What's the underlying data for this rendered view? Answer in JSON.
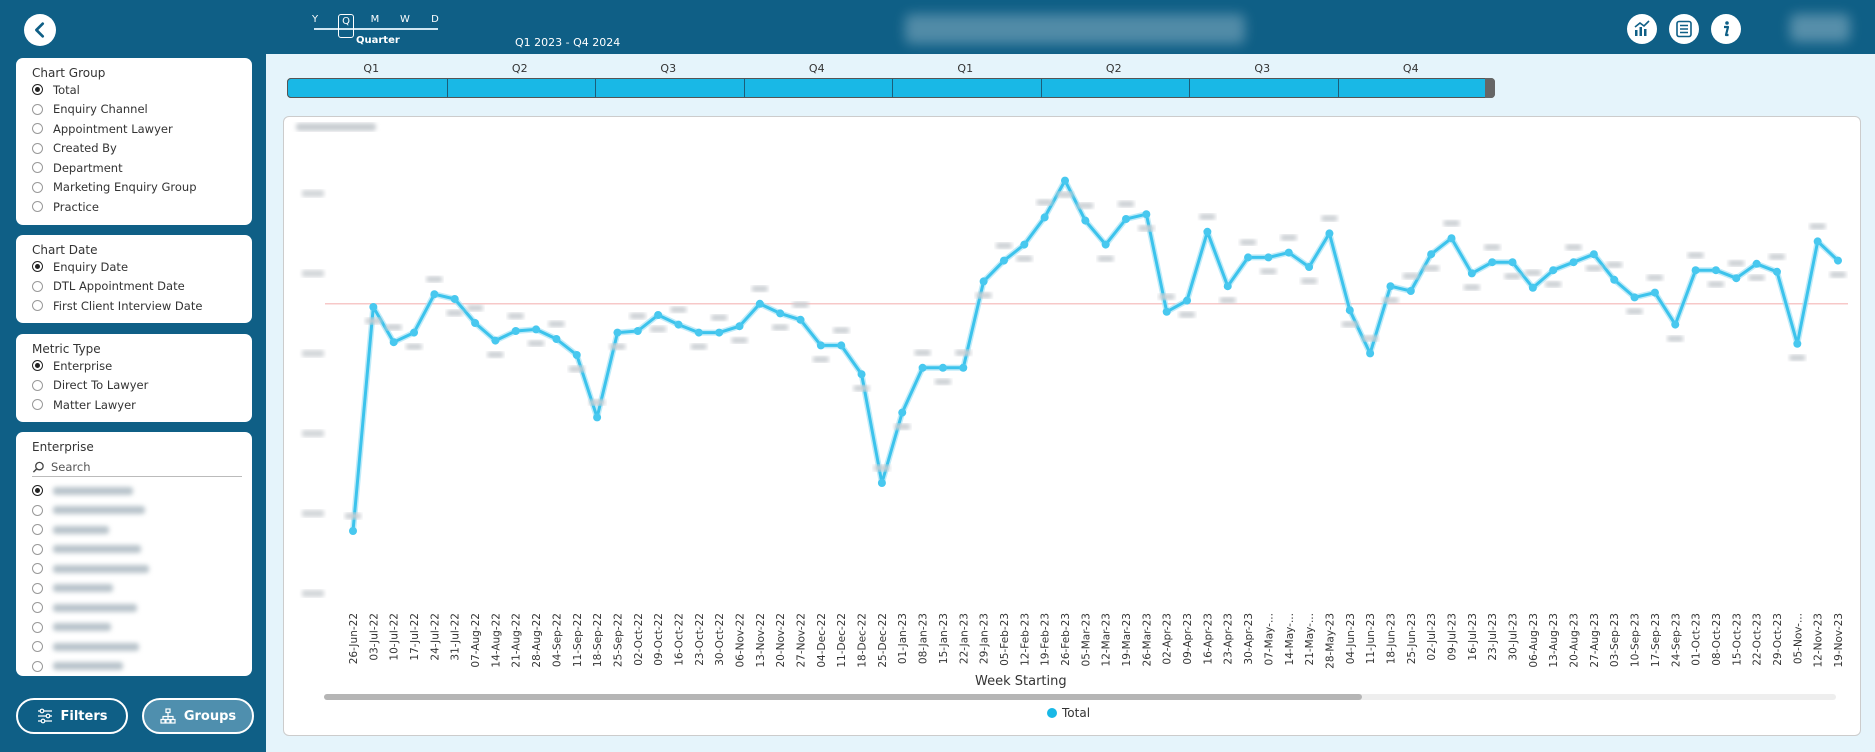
{
  "header": {
    "back_icon": "chevron-left-icon",
    "slicer": {
      "options": [
        "Y",
        "Q",
        "M",
        "W",
        "D"
      ],
      "selected": "Q",
      "selected_label": "Quarter"
    },
    "range_label": "Q1 2023 - Q4 2024",
    "icons": [
      "chart-analytics-icon",
      "list-report-icon",
      "info-icon"
    ]
  },
  "sidebar": {
    "chart_group": {
      "title": "Chart Group",
      "options": [
        "Total",
        "Enquiry Channel",
        "Appointment Lawyer",
        "Created By",
        "Department",
        "Marketing Enquiry Group",
        "Practice"
      ],
      "selected": "Total"
    },
    "chart_date": {
      "title": "Chart Date",
      "options": [
        "Enquiry Date",
        "DTL Appointment Date",
        "First Client Interview Date"
      ],
      "selected": "Enquiry Date"
    },
    "metric_type": {
      "title": "Metric Type",
      "options": [
        "Enterprise",
        "Direct To Lawyer",
        "Matter Lawyer"
      ],
      "selected": "Enterprise"
    },
    "enterprise": {
      "title": "Enterprise",
      "search_placeholder": "Search"
    },
    "filters_label": "Filters",
    "groups_label": "Groups"
  },
  "timeline": {
    "quarters": [
      "Q1",
      "Q2",
      "Q3",
      "Q4",
      "Q1",
      "Q2",
      "Q3",
      "Q4"
    ]
  },
  "chart_data": {
    "type": "line",
    "x": [
      "26-Jun-22",
      "03-Jul-22",
      "10-Jul-22",
      "17-Jul-22",
      "24-Jul-22",
      "31-Jul-22",
      "07-Aug-22",
      "14-Aug-22",
      "21-Aug-22",
      "28-Aug-22",
      "04-Sep-22",
      "11-Sep-22",
      "18-Sep-22",
      "25-Sep-22",
      "02-Oct-22",
      "09-Oct-22",
      "16-Oct-22",
      "23-Oct-22",
      "30-Oct-22",
      "06-Nov-22",
      "13-Nov-22",
      "20-Nov-22",
      "27-Nov-22",
      "04-Dec-22",
      "11-Dec-22",
      "18-Dec-22",
      "25-Dec-22",
      "01-Jan-23",
      "08-Jan-23",
      "15-Jan-23",
      "22-Jan-23",
      "29-Jan-23",
      "05-Feb-23",
      "12-Feb-23",
      "19-Feb-23",
      "26-Feb-23",
      "05-Mar-23",
      "12-Mar-23",
      "19-Mar-23",
      "26-Mar-23",
      "02-Apr-23",
      "09-Apr-23",
      "16-Apr-23",
      "23-Apr-23",
      "30-Apr-23",
      "07-May-...",
      "14-May-...",
      "21-May-...",
      "28-May-23",
      "04-Jun-23",
      "11-Jun-23",
      "18-Jun-23",
      "25-Jun-23",
      "02-Jul-23",
      "09-Jul-23",
      "16-Jul-23",
      "23-Jul-23",
      "30-Jul-23",
      "06-Aug-23",
      "13-Aug-23",
      "20-Aug-23",
      "27-Aug-23",
      "03-Sep-23",
      "10-Sep-23",
      "17-Sep-23",
      "24-Sep-23",
      "01-Oct-23",
      "08-Oct-23",
      "15-Oct-23",
      "22-Oct-23",
      "29-Oct-23",
      "05-Nov-...",
      "12-Nov-23",
      "19-Nov-23"
    ],
    "y": [
      40,
      180,
      158,
      164,
      188,
      185,
      170,
      159,
      165,
      166,
      160,
      150,
      111,
      164,
      165,
      175,
      169,
      164,
      164,
      168,
      182,
      176,
      172,
      156,
      156,
      138,
      70,
      114,
      142,
      142,
      142,
      196,
      209,
      219,
      236,
      259,
      234,
      219,
      235,
      238,
      177,
      184,
      227,
      193,
      211,
      211,
      214,
      205,
      226,
      178,
      151,
      193,
      190,
      213,
      223,
      201,
      208,
      208,
      192,
      203,
      208,
      213,
      197,
      186,
      189,
      169,
      203,
      203,
      198,
      207,
      202,
      157,
      221,
      209
    ],
    "ylim": [
      0,
      280
    ],
    "reference_line": true,
    "grid": false,
    "xlabel": "Week Starting",
    "series": [
      {
        "name": "Total"
      }
    ],
    "legend": "bottom-center"
  }
}
